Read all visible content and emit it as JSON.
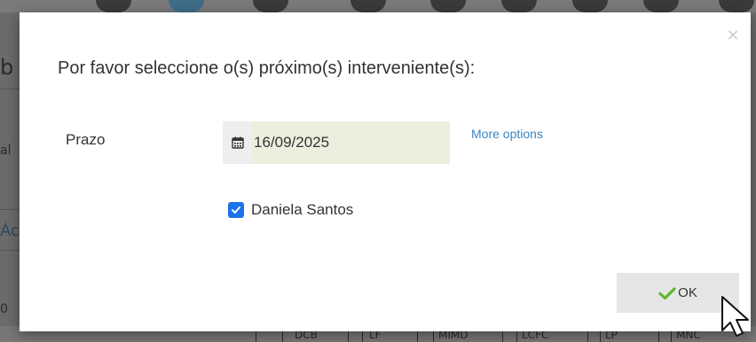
{
  "modal": {
    "title": "Por favor seleccione o(s) próximo(s) interveniente(s):",
    "close_symbol": "×",
    "deadline_label": "Prazo",
    "deadline_value": "16/09/2025",
    "more_options_label": "More options",
    "assignee_name": "Daniela Santos",
    "assignee_checked": true,
    "ok_label": "OK"
  },
  "background": {
    "left_fragments": [
      "b",
      "al",
      "Ác",
      "0"
    ],
    "bottom_labels": [
      "DCB",
      "LF",
      "MIMD",
      "LCFC",
      "LP",
      "MNC"
    ]
  },
  "icons": {
    "calendar": "calendar-icon",
    "check": "checkmark-icon",
    "checkbox": "checkbox-checked-icon",
    "pointer": "mouse-pointer-icon"
  },
  "colors": {
    "date_field_bg": "#eeeedf",
    "link": "#3a86c8",
    "checkbox": "#1a73e8",
    "ok_check": "#5cb82a",
    "ok_button_bg": "#e6e6e6"
  }
}
